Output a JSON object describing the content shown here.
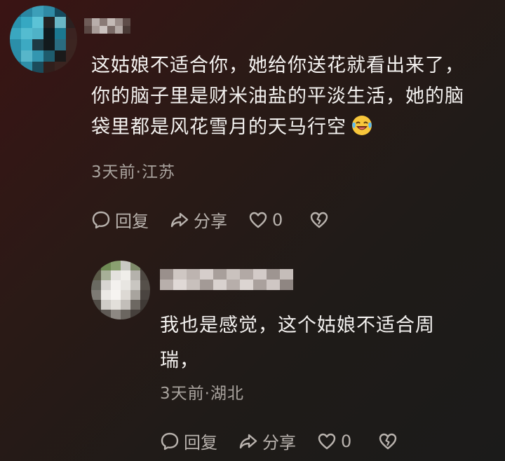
{
  "comment": {
    "line1": "这姑娘不适合你，她给你送花就看出来了，",
    "line2": "你的脑子里是财米油盐的平淡生活，她的脑",
    "line3": "袋里都是风花雪月的天马行空",
    "emoji": "laughing-crying-emoji",
    "meta": "3天前·江苏",
    "reply_label": "回复",
    "share_label": "分享",
    "like_count": "0"
  },
  "reply": {
    "line1": "我也是感觉，这个姑娘不适合周",
    "line2": "瑞，",
    "meta": "3天前·湖北",
    "reply_label": "回复",
    "share_label": "分享",
    "like_count": "0"
  },
  "icons": [
    "comment-bubble-icon",
    "share-arrow-icon",
    "heart-icon",
    "broken-heart-icon"
  ]
}
